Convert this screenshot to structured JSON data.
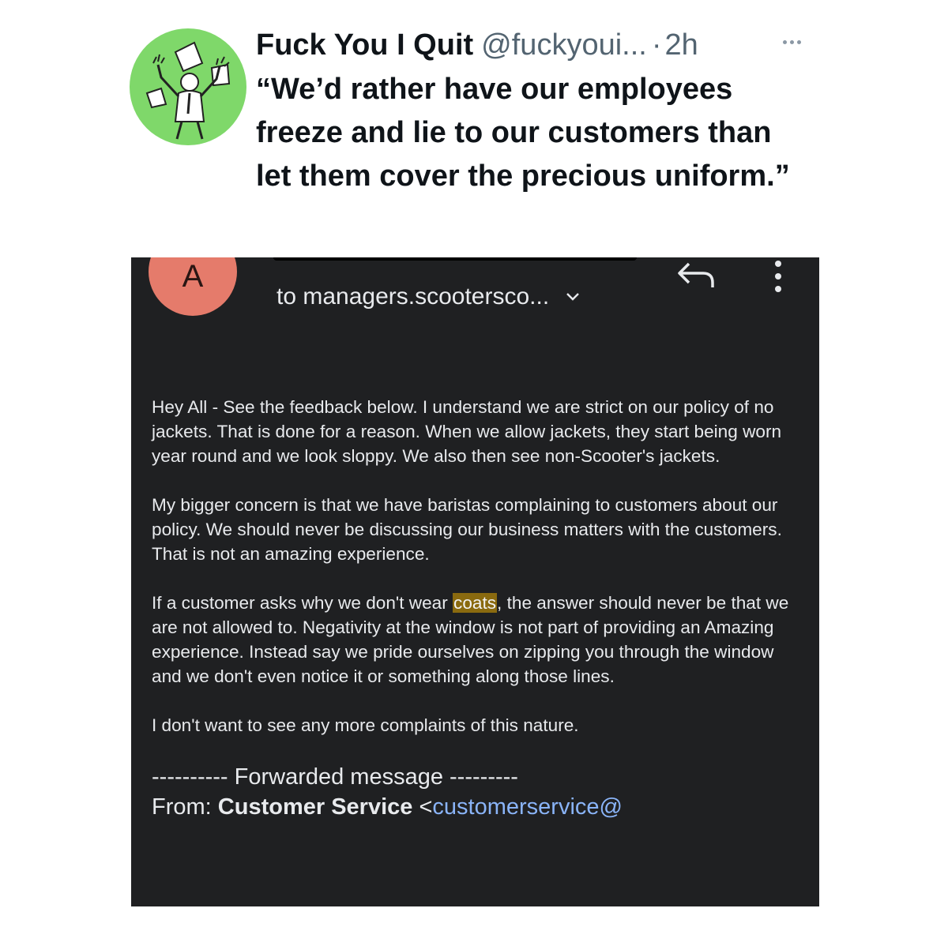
{
  "tweet": {
    "display_name": "Fuck You I Quit",
    "handle": "@fuckyoui...",
    "separator": "·",
    "time": "2h",
    "text": "“We’d rather have our employees freeze and lie to our customers than let them cover the precious uniform.”"
  },
  "email": {
    "sender_initial": "A",
    "recipient": "to managers.scootersco...",
    "body": {
      "p1": "Hey All - See the feedback below.  I understand we are strict on our policy of no jackets.  That is done for a reason.  When we allow jackets, they start being worn year round and we look sloppy.  We also then see non-Scooter's jackets.",
      "p2": "My bigger concern is that we have baristas complaining to customers about our policy.  We should never be discussing our business matters with the customers.  That is not an amazing experience.",
      "p3_before": "If a customer asks why we don't wear ",
      "p3_highlight": "coats",
      "p3_after": ", the answer should never be that we are not allowed to.  Negativity at the window is not part of providing an Amazing experience.  Instead say we pride ourselves on zipping you through the window and we don't even notice it or something along those lines.",
      "p4": "I don't want to see any more complaints of this nature."
    },
    "forwarded_label": "---------- Forwarded message ---------",
    "from_label": "From:",
    "from_name": "Customer Service",
    "from_email_open": "<",
    "from_email": "customerservice@"
  },
  "colors": {
    "avatar_bg": "#7fd86a",
    "email_bg": "#1f2022",
    "sender_avatar": "#e57b6b",
    "highlight": "#8a6a0f",
    "link": "#8ab4f8"
  }
}
